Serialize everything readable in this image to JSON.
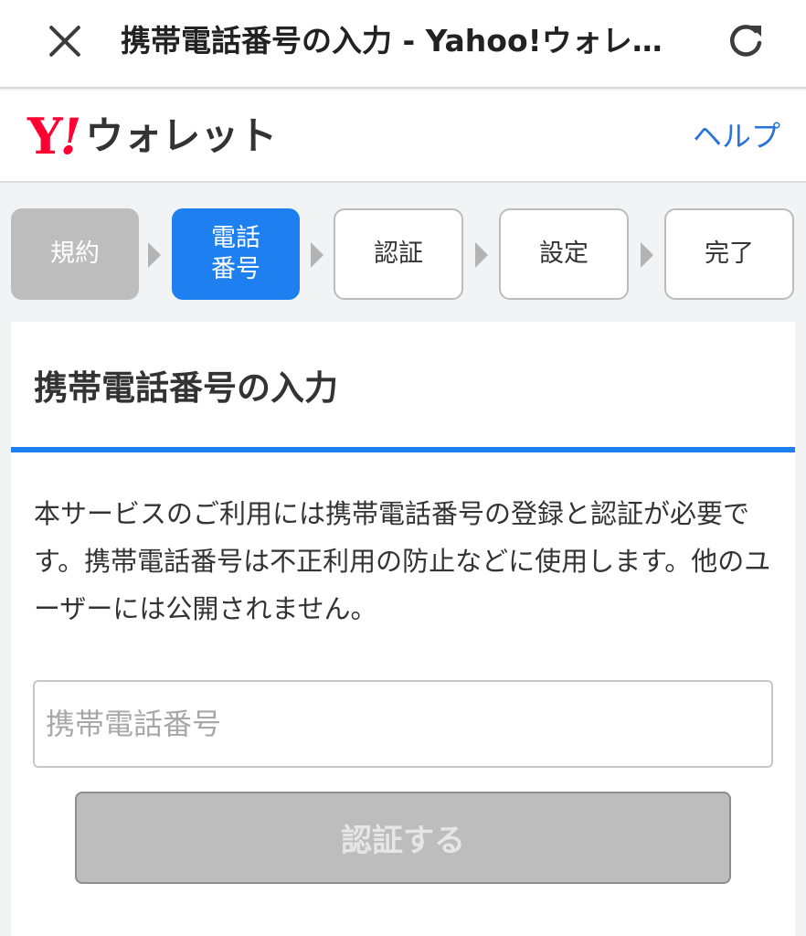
{
  "browser": {
    "title": "携帯電話番号の入力 - Yahoo!ウォレ…",
    "close_icon": "close-icon",
    "reload_icon": "reload-icon"
  },
  "header": {
    "logo_y": "Y",
    "logo_bang": "!",
    "logo_text": "ウォレット",
    "help_label": "ヘルプ",
    "brand_color": "#ff0033",
    "link_color": "#2a74d9"
  },
  "steps": [
    {
      "label": "規約",
      "state": "done"
    },
    {
      "label": "電話\n番号",
      "state": "current"
    },
    {
      "label": "認証",
      "state": "pending"
    },
    {
      "label": "設定",
      "state": "pending"
    },
    {
      "label": "完了",
      "state": "pending"
    }
  ],
  "main": {
    "title": "携帯電話番号の入力",
    "description": "本サービスのご利用には携帯電話番号の登録と認証が必要です。携帯電話番号は不正利用の防止などに使用します。他のユーザーには公開されません。",
    "phone_placeholder": "携帯電話番号",
    "phone_value": "",
    "submit_label": "認証する",
    "accent_color": "#1e80f0"
  }
}
